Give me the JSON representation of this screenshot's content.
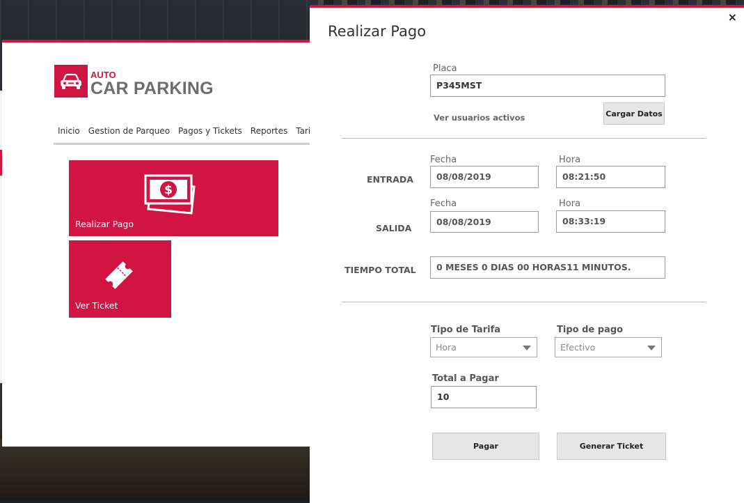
{
  "app": {
    "logo_small": "AUTO",
    "logo_main": "CAR PARKING",
    "nav": [
      "Inicio",
      "Gestion de Parqueo",
      "Pagos y Tickets",
      "Reportes",
      "Tarifas"
    ],
    "active_nav": "Pagos y Tickets",
    "tiles": {
      "pay_label": "Realizar Pago",
      "ticket_label": "Ver Ticket"
    }
  },
  "dialog": {
    "title": "Realizar Pago",
    "close": "×",
    "plate": {
      "label": "Placa",
      "value": "P345MST"
    },
    "active_users_link": "Ver usuarios activos",
    "load_button": "Cargar Datos",
    "entry": {
      "label": "ENTRADA",
      "date_label": "Fecha",
      "date": "08/08/2019",
      "time_label": "Hora",
      "time": "08:21:50"
    },
    "exit": {
      "label": "SALIDA",
      "date_label": "Fecha",
      "date": "08/08/2019",
      "time_label": "Hora",
      "time": "08:33:19"
    },
    "total_time": {
      "label": "TIEMPO TOTAL",
      "value": "0 MESES 0 DIAS 00 HORAS11 MINUTOS."
    },
    "rate_type": {
      "label": "Tipo de Tarifa",
      "selected": "Hora"
    },
    "payment_type": {
      "label": "Tipo de pago",
      "selected": "Efectivo"
    },
    "total": {
      "label": "Total a Pagar",
      "value": "10"
    },
    "pay_button": "Pagar",
    "ticket_button": "Generar Ticket"
  },
  "colors": {
    "accent": "#d11543"
  }
}
